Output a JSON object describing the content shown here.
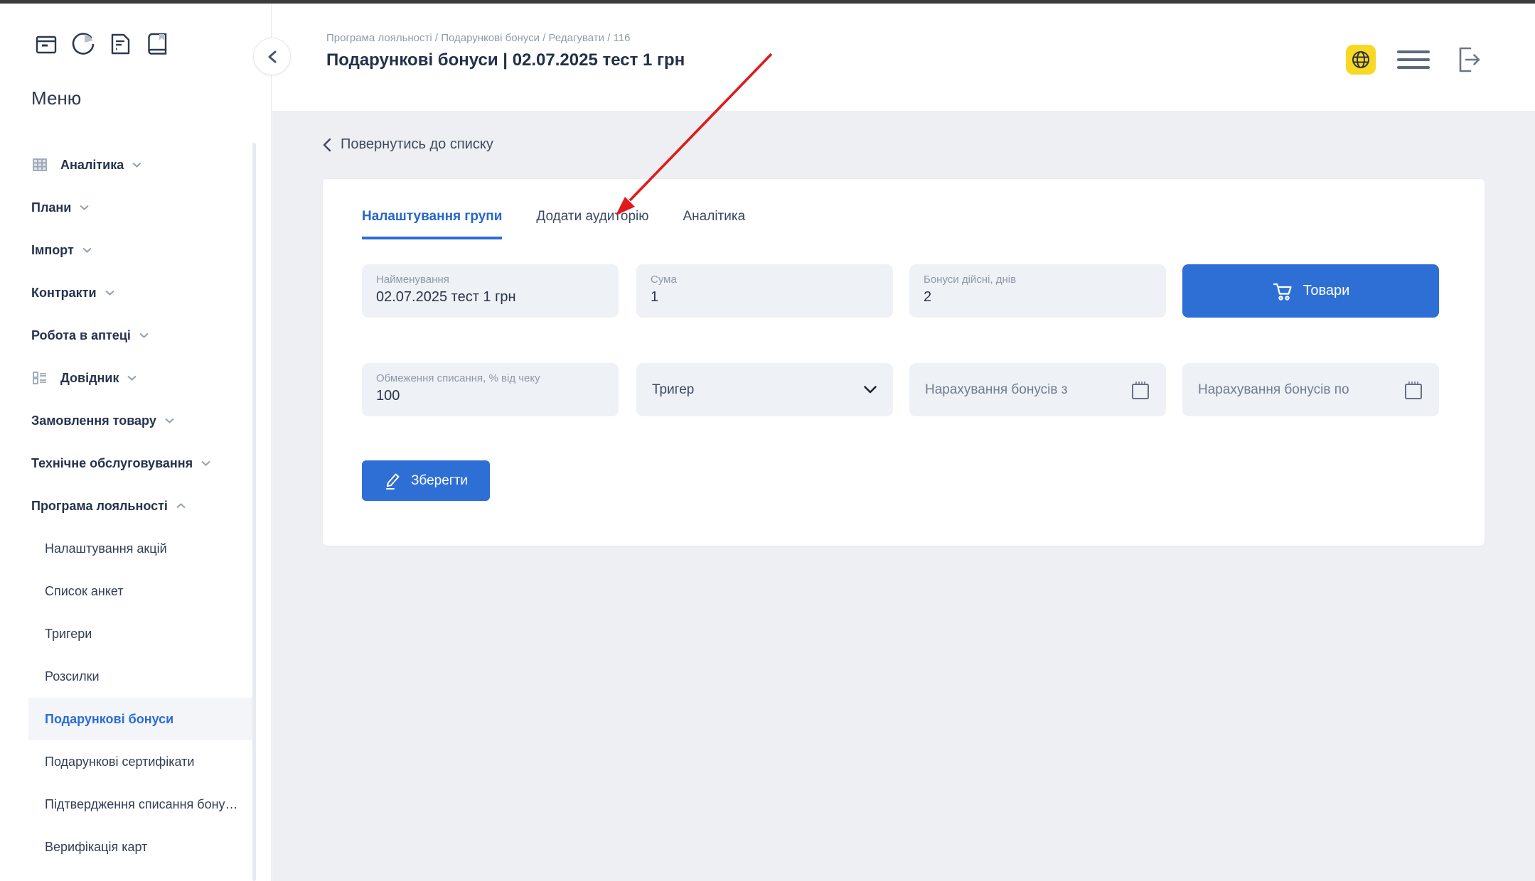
{
  "sidebar": {
    "menu_title": "Меню",
    "toolbar_icons": [
      "box-icon",
      "pie-chart-icon",
      "document-icon",
      "book-icon"
    ],
    "items": [
      {
        "label": "Аналітика"
      },
      {
        "label": "Плани"
      },
      {
        "label": "Імпорт"
      },
      {
        "label": "Контракти"
      },
      {
        "label": "Робота в аптеці"
      },
      {
        "label": "Довідник"
      },
      {
        "label": "Замовлення товару"
      },
      {
        "label": "Технічне обслуговування"
      },
      {
        "label": "Програма лояльності"
      },
      {
        "label": "Налаштування акцій"
      },
      {
        "label": "Список анкет"
      },
      {
        "label": "Тригери"
      },
      {
        "label": "Розсилки"
      },
      {
        "label": "Подарункові бонуси"
      },
      {
        "label": "Подарункові сертифікати"
      },
      {
        "label": "Підтвердження списання бону…"
      },
      {
        "label": "Верифікація карт"
      }
    ],
    "active_item": "Подарункові бонуси"
  },
  "header": {
    "breadcrumb": "Програма лояльності / Подарункові бонуси / Редагувати / 116",
    "title": "Подарункові бонуси | 02.07.2025 тест 1 грн"
  },
  "content": {
    "back_link": "Повернутись до списку",
    "tabs": [
      {
        "label": "Налаштування групи",
        "active": true
      },
      {
        "label": "Додати аудиторію",
        "active": false
      },
      {
        "label": "Аналітика",
        "active": false
      }
    ],
    "fields": {
      "name": {
        "label": "Найменування",
        "value": "02.07.2025 тест 1 грн"
      },
      "sum": {
        "label": "Сума",
        "value": "1"
      },
      "bonus_days": {
        "label": "Бонуси дійсні, днів",
        "value": "2"
      },
      "writeoff_limit": {
        "label": "Обмеження списання, % від чеку",
        "value": "100"
      },
      "trigger": {
        "label": "Тригер"
      },
      "accrual_from": {
        "label": "Нарахування бонусів з"
      },
      "accrual_to": {
        "label": "Нарахування бонусів по"
      }
    },
    "buttons": {
      "products": "Товари",
      "save": "Зберегти"
    }
  },
  "annotation": {
    "type": "red-arrow",
    "points_to": "Додати аудиторію"
  },
  "colors": {
    "accent": "#2c6dd5",
    "globe_bg": "#f8d823",
    "arrow_red": "#e01a1a",
    "page_bg": "#edeff3"
  }
}
